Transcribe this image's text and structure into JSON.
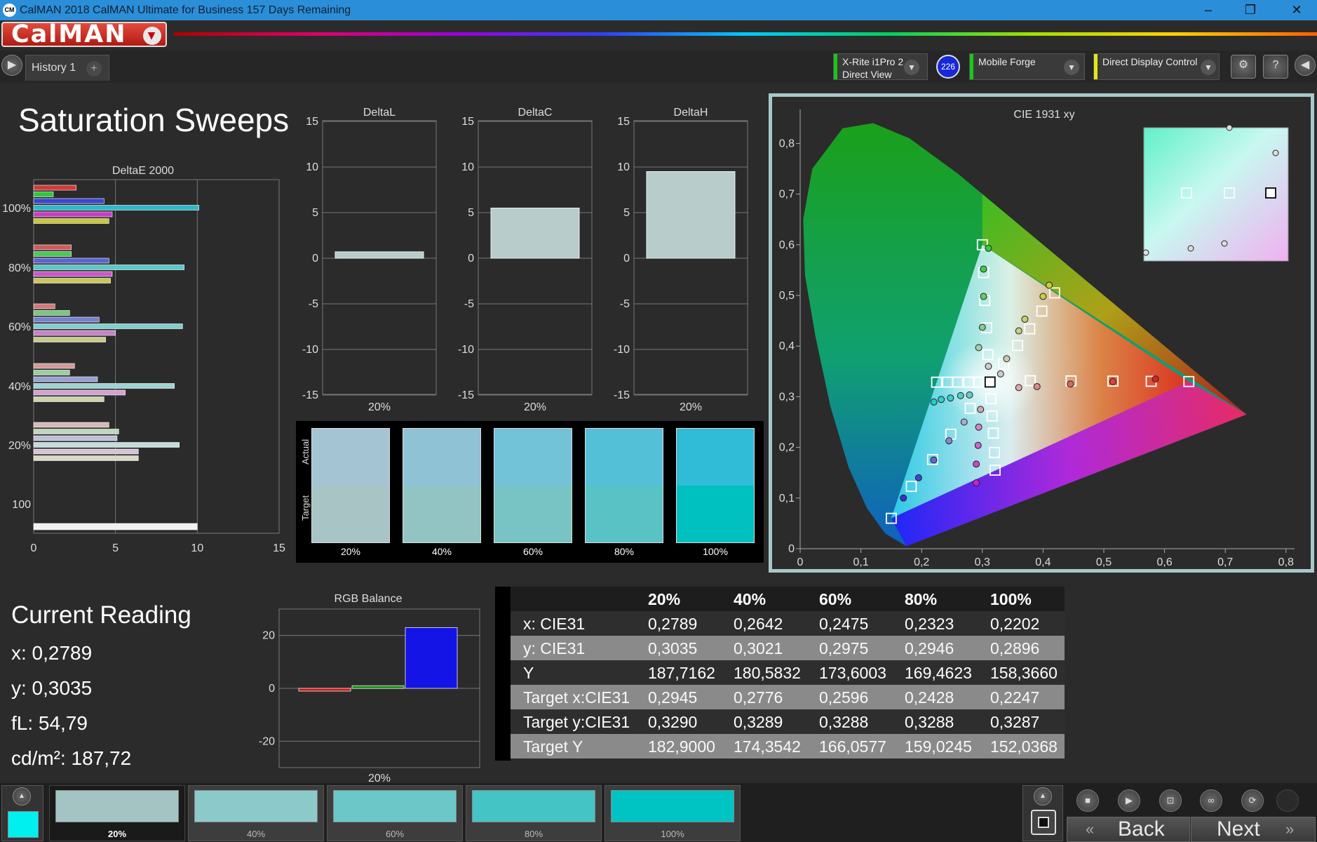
{
  "window": {
    "title": "CalMAN 2018 CalMAN Ultimate for Business 157 Days Remaining",
    "app_icon": "CM",
    "minimize": "‒",
    "restore": "❐",
    "close": "✕"
  },
  "brand": {
    "logo": "CalMAN"
  },
  "tabs": [
    {
      "label": "History 1"
    }
  ],
  "devices": {
    "meter": {
      "line1": "X-Rite i1Pro 2",
      "line2": "Direct View",
      "badge": "226",
      "color": "#19c819"
    },
    "source": {
      "line1": "Mobile Forge",
      "color": "#19c819"
    },
    "display": {
      "line1": "Direct Display Control",
      "color": "#e6e619"
    }
  },
  "page": {
    "heading": "Saturation Sweeps"
  },
  "deltae_chart": {
    "title": "DeltaE 2000",
    "x_ticks": [
      "0",
      "5",
      "10",
      "15"
    ],
    "groups": [
      {
        "label": "100%",
        "values": [
          {
            "c": "#d23a3a",
            "v": 2.6
          },
          {
            "c": "#2fc83c",
            "v": 1.2
          },
          {
            "c": "#3c46d2",
            "v": 4.3
          },
          {
            "c": "#2fb9c8",
            "v": 10.1
          },
          {
            "c": "#c83cc8",
            "v": 4.8
          },
          {
            "c": "#c8c83c",
            "v": 4.6
          }
        ]
      },
      {
        "label": "80%",
        "values": [
          {
            "c": "#d25a5a",
            "v": 2.3
          },
          {
            "c": "#4cc85a",
            "v": 2.3
          },
          {
            "c": "#5a64d2",
            "v": 4.6
          },
          {
            "c": "#5ac8c8",
            "v": 9.2
          },
          {
            "c": "#c85ac8",
            "v": 4.8
          },
          {
            "c": "#c8c85a",
            "v": 4.7
          }
        ]
      },
      {
        "label": "60%",
        "values": [
          {
            "c": "#d27878",
            "v": 1.3
          },
          {
            "c": "#78c87e",
            "v": 2.2
          },
          {
            "c": "#7880d2",
            "v": 4.0
          },
          {
            "c": "#80cfd0",
            "v": 9.1
          },
          {
            "c": "#c882c8",
            "v": 5.0
          },
          {
            "c": "#c8c88a",
            "v": 4.4
          }
        ]
      },
      {
        "label": "40%",
        "values": [
          {
            "c": "#d49a9a",
            "v": 2.5
          },
          {
            "c": "#9ad09e",
            "v": 2.2
          },
          {
            "c": "#9aa0d4",
            "v": 3.9
          },
          {
            "c": "#a0d4d4",
            "v": 8.6
          },
          {
            "c": "#d2a2d2",
            "v": 5.6
          },
          {
            "c": "#d2d2aa",
            "v": 4.3
          }
        ]
      },
      {
        "label": "20%",
        "values": [
          {
            "c": "#d8b8b8",
            "v": 4.6
          },
          {
            "c": "#bcd8be",
            "v": 5.2
          },
          {
            "c": "#bcc0d8",
            "v": 5.1
          },
          {
            "c": "#c2dcdc",
            "v": 8.9
          },
          {
            "c": "#d8c2d8",
            "v": 6.4
          },
          {
            "c": "#d8d8c4",
            "v": 6.4
          }
        ]
      },
      {
        "label": "100",
        "values": [
          {
            "c": "#f2f2f2",
            "v": 10.0
          }
        ]
      }
    ]
  },
  "delta_charts": [
    {
      "title": "DeltaL",
      "value": 0.7,
      "x_label": "20%"
    },
    {
      "title": "DeltaC",
      "value": 5.5,
      "x_label": "20%"
    },
    {
      "title": "DeltaH",
      "value": 9.5,
      "x_label": "20%"
    }
  ],
  "delta_y_ticks": [
    "15",
    "10",
    "5",
    "0",
    "-5",
    "-10",
    "-15"
  ],
  "swatch_panel": {
    "actual_label": "Actual",
    "target_label": "Target",
    "items": [
      {
        "label": "20%",
        "actual": "#a4c4d4",
        "target": "#a8c4c4"
      },
      {
        "label": "40%",
        "actual": "#8ec2d4",
        "target": "#92c4c4"
      },
      {
        "label": "60%",
        "actual": "#72c2d8",
        "target": "#78c4c4"
      },
      {
        "label": "80%",
        "actual": "#54c0d8",
        "target": "#58c2c4"
      },
      {
        "label": "100%",
        "actual": "#30bcd6",
        "target": "#00c0c0"
      }
    ]
  },
  "cie": {
    "title": "CIE 1931 xy",
    "x_ticks": [
      "0",
      "0,1",
      "0,2",
      "0,3",
      "0,4",
      "0,5",
      "0,6",
      "0,7",
      "0,8"
    ],
    "y_ticks": [
      "0",
      "0,1",
      "0,2",
      "0,3",
      "0,4",
      "0,5",
      "0,6",
      "0,7",
      "0,8"
    ],
    "white": [
      0.3127,
      0.329
    ],
    "targets": [
      [
        0.64,
        0.33
      ],
      [
        0.578,
        0.3304
      ],
      [
        0.515,
        0.3308
      ],
      [
        0.446,
        0.3312
      ],
      [
        0.379,
        0.3316
      ],
      [
        0.321,
        0.155
      ],
      [
        0.32,
        0.19
      ],
      [
        0.318,
        0.228
      ],
      [
        0.316,
        0.262
      ],
      [
        0.314,
        0.296
      ],
      [
        0.3,
        0.6
      ],
      [
        0.302,
        0.545
      ],
      [
        0.304,
        0.49
      ],
      [
        0.307,
        0.436
      ],
      [
        0.309,
        0.383
      ],
      [
        0.15,
        0.06
      ],
      [
        0.183,
        0.123
      ],
      [
        0.218,
        0.176
      ],
      [
        0.248,
        0.226
      ],
      [
        0.28,
        0.277
      ],
      [
        0.2947,
        0.3289
      ],
      [
        0.2776,
        0.3289
      ],
      [
        0.2596,
        0.3288
      ],
      [
        0.2428,
        0.3288
      ],
      [
        0.2247,
        0.3287
      ],
      [
        0.419,
        0.505
      ],
      [
        0.398,
        0.469
      ],
      [
        0.378,
        0.434
      ],
      [
        0.358,
        0.401
      ],
      [
        0.335,
        0.365
      ]
    ],
    "measured": [
      [
        0.585,
        0.335
      ],
      [
        0.515,
        0.33
      ],
      [
        0.445,
        0.325
      ],
      [
        0.39,
        0.32
      ],
      [
        0.36,
        0.318
      ],
      [
        0.29,
        0.13
      ],
      [
        0.29,
        0.167
      ],
      [
        0.293,
        0.204
      ],
      [
        0.294,
        0.24
      ],
      [
        0.297,
        0.275
      ],
      [
        0.31,
        0.593
      ],
      [
        0.302,
        0.552
      ],
      [
        0.302,
        0.498
      ],
      [
        0.3,
        0.437
      ],
      [
        0.294,
        0.397
      ],
      [
        0.17,
        0.1
      ],
      [
        0.195,
        0.14
      ],
      [
        0.22,
        0.175
      ],
      [
        0.245,
        0.213
      ],
      [
        0.27,
        0.25
      ],
      [
        0.2789,
        0.3035
      ],
      [
        0.2642,
        0.3021
      ],
      [
        0.2475,
        0.2975
      ],
      [
        0.2323,
        0.2946
      ],
      [
        0.2202,
        0.2896
      ],
      [
        0.41,
        0.52
      ],
      [
        0.4,
        0.498
      ],
      [
        0.37,
        0.453
      ],
      [
        0.36,
        0.43
      ],
      [
        0.34,
        0.375
      ],
      [
        0.33,
        0.345
      ],
      [
        0.31,
        0.36
      ]
    ],
    "measured_colors": [
      "#d22",
      "#d44",
      "#d66",
      "#d88",
      "#daa",
      "#c2c",
      "#c4c",
      "#c6c",
      "#c8c",
      "#caa",
      "#3c3",
      "#4c4",
      "#6c6",
      "#8c8",
      "#aca",
      "#33c",
      "#44c",
      "#66c",
      "#88c",
      "#aac",
      "#6cc",
      "#5cc",
      "#4cc",
      "#3cc",
      "#2cc",
      "#cc3",
      "#cc4",
      "#cc6",
      "#cc8",
      "#cca",
      "#ccc",
      "#ccc"
    ]
  },
  "current_reading": {
    "title": "Current Reading",
    "x": "x: 0,2789",
    "y": "y: 0,3035",
    "fl": "fL: 54,79",
    "cd": "cd/m²: 187,72"
  },
  "rgb_balance": {
    "title": "RGB Balance",
    "values": [
      -1,
      1,
      23
    ],
    "colors": [
      "#d21414",
      "#1c8c1c",
      "#1414e6"
    ],
    "y_ticks": [
      "20",
      "0",
      "-20"
    ],
    "x_label": "20%"
  },
  "table": {
    "columns": [
      "",
      "20%",
      "40%",
      "60%",
      "80%",
      "100%"
    ],
    "rows": [
      [
        "x: CIE31",
        "0,2789",
        "0,2642",
        "0,2475",
        "0,2323",
        "0,2202"
      ],
      [
        "y: CIE31",
        "0,3035",
        "0,3021",
        "0,2975",
        "0,2946",
        "0,2896"
      ],
      [
        "Y",
        "187,7162",
        "180,5832",
        "173,6003",
        "169,4623",
        "158,3660"
      ],
      [
        "Target x:CIE31",
        "0,2945",
        "0,2776",
        "0,2596",
        "0,2428",
        "0,2247"
      ],
      [
        "Target y:CIE31",
        "0,3290",
        "0,3289",
        "0,3288",
        "0,3288",
        "0,3287"
      ],
      [
        "Target Y",
        "182,9000",
        "174,3542",
        "166,0577",
        "159,0245",
        "152,0368"
      ]
    ]
  },
  "bottom": {
    "current_color": "#00f0f0",
    "swatches": [
      {
        "label": "20%",
        "color": "#a4c4c4"
      },
      {
        "label": "40%",
        "color": "#8ccaca"
      },
      {
        "label": "60%",
        "color": "#6cc8c8"
      },
      {
        "label": "80%",
        "color": "#44c4c4"
      },
      {
        "label": "100%",
        "color": "#00c4c4"
      }
    ],
    "back_label": "Back",
    "next_label": "Next"
  }
}
